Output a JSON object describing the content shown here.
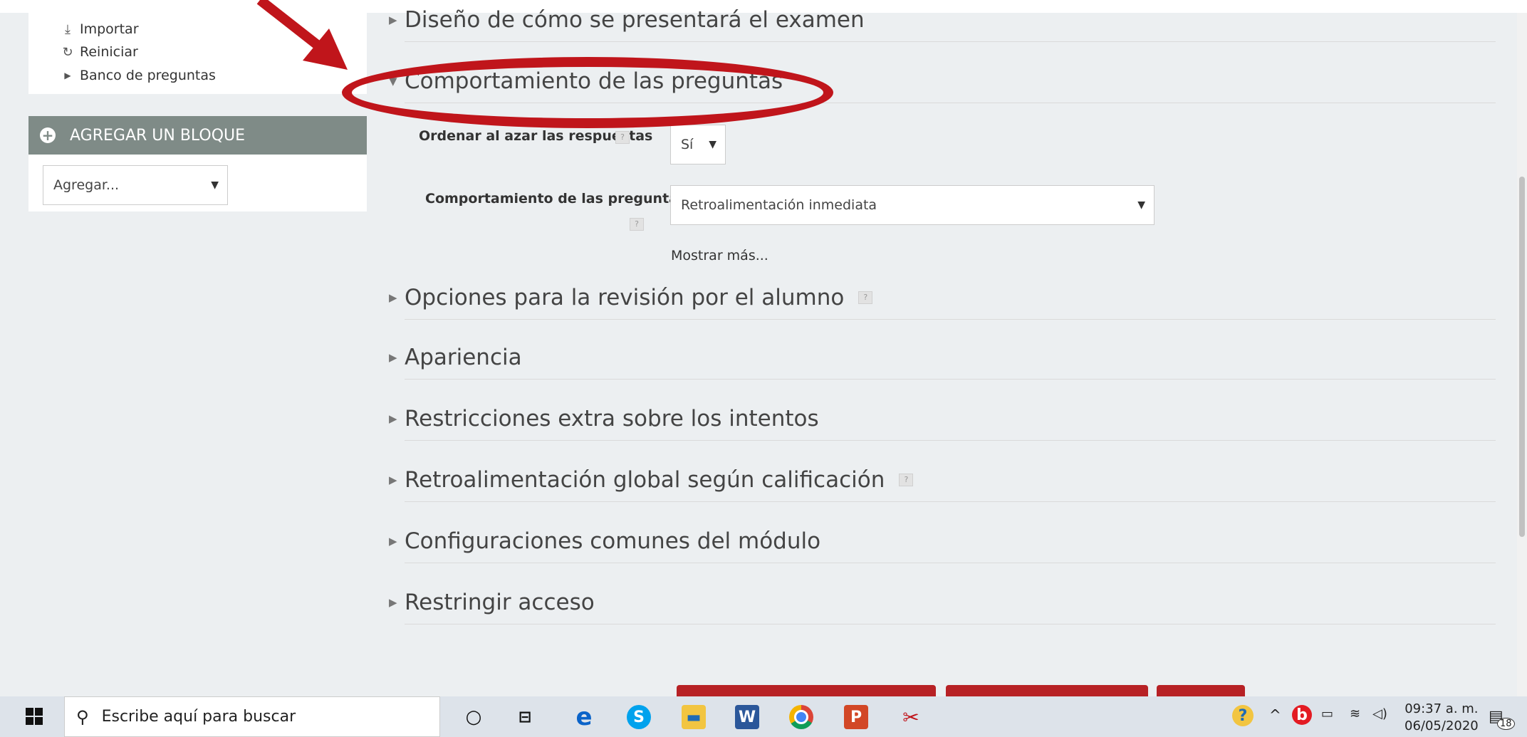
{
  "sidebar": {
    "items": [
      {
        "label": "Importar",
        "icon": "download-icon"
      },
      {
        "label": "Reiniciar",
        "icon": "refresh-icon"
      },
      {
        "label": "Banco de preguntas",
        "icon": "chevron-right-icon"
      }
    ],
    "add_block": {
      "title": "AGREGAR UN BLOQUE",
      "select_value": "Agregar..."
    }
  },
  "sections": [
    {
      "title": "Diseño de cómo se presentará el examen",
      "expanded": false
    },
    {
      "title": "Comportamiento de las preguntas",
      "expanded": true
    },
    {
      "title": "Opciones para la revisión por el alumno",
      "expanded": false
    },
    {
      "title": "Apariencia",
      "expanded": false
    },
    {
      "title": "Restricciones extra sobre los intentos",
      "expanded": false
    },
    {
      "title": "Retroalimentación global según calificación",
      "expanded": false
    },
    {
      "title": "Configuraciones comunes del módulo",
      "expanded": false
    },
    {
      "title": "Restringir acceso",
      "expanded": false
    }
  ],
  "question_behaviour": {
    "shuffle_label": "Ordenar al azar las respuestas",
    "shuffle_value": "Sí",
    "behaviour_label": "Comportamiento de las preguntas",
    "behaviour_value": "Retroalimentación inmediata",
    "show_more": "Mostrar más..."
  },
  "taskbar": {
    "search_placeholder": "Escribe aquí para buscar",
    "time": "09:37 a. m.",
    "date": "06/05/2020",
    "notifications": "18"
  },
  "colors": {
    "accent": "#b72125",
    "annotation": "#c0151b",
    "block_header": "#7f8b87"
  }
}
